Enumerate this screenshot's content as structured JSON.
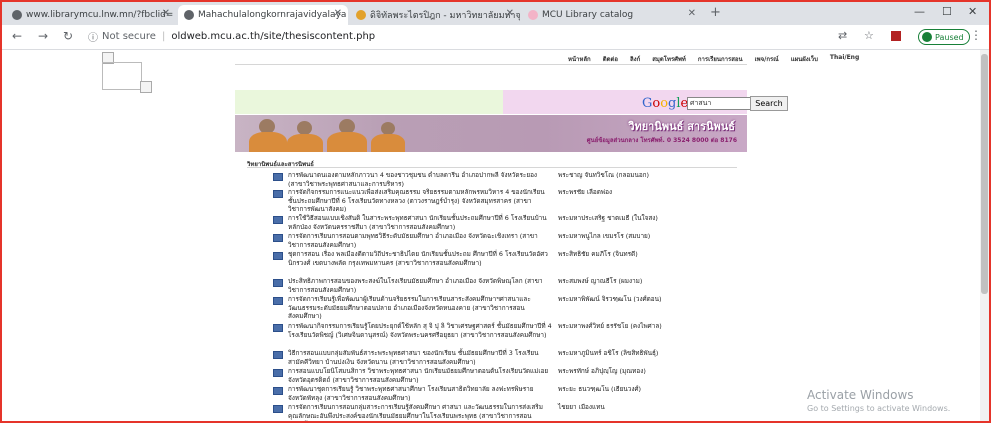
{
  "browser": {
    "tabs": [
      {
        "title": "www.librarymcu.lnw.mn/?fbclid=",
        "active": false
      },
      {
        "title": "Mahachulalongkornrajavidyalaya",
        "active": true
      },
      {
        "title": "ดิจิทัลพระไตรปิฎก - มหาวิทยาลัยมหาจุฬาฯ",
        "active": false
      },
      {
        "title": "MCU Library catalog",
        "active": false
      }
    ],
    "new_tab": "+",
    "not_secure": "Not secure",
    "url": "oldweb.mcu.ac.th/site/thesiscontent.php",
    "profile_status": "Paused"
  },
  "site": {
    "nav": [
      "หน้าหลัก",
      "ติดต่อ",
      "ลิงก์",
      "สมุดโทรศัพท์",
      "การเรียนการสอน",
      "เพจ/กรณ์",
      "แผนผังเว็บ",
      "Thai/Eng"
    ],
    "search": {
      "logo": "Google",
      "value": "ศาสนา",
      "button": "Search"
    },
    "banner": {
      "title": "วิทยานิพนธ์ สารนิพนธ์",
      "subtitle": "ศูนย์ข้อมูลส่วนกลาง โทรศัพท์. 0 3524 8000 ต่อ 8176"
    },
    "section_title": "วิทยานิพนธ์และสารนิพนธ์",
    "theses": [
      {
        "title": "การพัฒนาตนเองตามหลักภาวนา 4 ของชาวชุมชน ตำบลดารีน อำเภอปากพลี จังหวัดระยอง (สาขาวิชาพระพุทธศาสนาและการบริหาร)",
        "author": "พระชาญ จันทวิชโณ (กลอมนอก)"
      },
      {
        "title": "การจัดกิจกรรมการแนะแนวเพื่อส่งเสริมคุณธรรม จริยธรรมตามหลักพรหมวิหาร 4 ของนักเรียนชั้นประถมศึกษาปีที่ 6 โรงเรียนวัดทางหลวง (ตาวงราษฎร์บำรุง) จังหวัดสมุทรสาคร (สาขาวิชาการพัฒนาสังคม)",
        "author": "พระพรชัย เลือดพ่อง"
      },
      {
        "title": "การใช้วิธีสอนแบบเชิงสันติ ในสาระพระพุทธศาสนา นักเรียนชั้นประถมศึกษาปีที่ 6 โรงเรียนบ้านหลักป่อง จังหวัดนครราชสีมา (สาขาวิชาการสอนสังคมศึกษา)",
        "author": "พระมหาประเสริฐ ชาตเมธี (ในใจสง)"
      },
      {
        "title": "การจัดการเรียนการสอนตามพุทธวิธีระดับมัธยมศึกษา อำเภอเมือง จังหวัดฉะเชิงเทรา (สาขาวิชาการสอนสังคมศึกษา)",
        "author": "พระมหาพนูไกล เขมรโร (สมบาย)"
      },
      {
        "title": "ชุดการสอน เรื่อง พลเมืองดีตามวิถีประชาธิปไตย นักเรียนชั้นประถม ศึกษาปีที่ 6 โรงเรียนวัดอัศวนิกรวงศ์ เขตบางพลัด กรุงเทพมหานคร (สาขาวิชาการสอนสังคมศึกษา)",
        "author": "พระสิทธิชัย คมภีโร (จินทรดี)"
      },
      {
        "title": "ประสิทธิภาพการสอนของพระสงฆ์ในโรงเรียนมัธยมศึกษา อำเภอเมือง จังหวัดพิษณุโลก (สาขาวิชาการสอนสังคมศึกษา)",
        "author": "พระสมพงษ์ ญาณธีโร (ผมงาม)"
      },
      {
        "title": "การจัดการเรียนรู้เพื่อพัฒนาผู้เรียนด้านจริยธรรมในการเรียนสาระสังคมศึกษาฯศาสนาและวัฒนธรรมระดับมัธยมศึกษาตอนปลาย อำเภอเมืองจังหวัดหนองคาย (สาขาวิชาการสอนสังคมศึกษา)",
        "author": "พระมหาพิพัฒน์ จิรวฑฺฒโน (วงศ์ดอน)"
      },
      {
        "title": "การพัฒนากิจกรรมการเรียนรู้โดยประยุกต์ใช้หลัก สุ จิ ปุ ลิ วิชาเศรษฐศาสตร์ ชั้นมัธยมศึกษาปีที่ 4 โรงเรียนวัดพิชญ์ (วิเศษจินดานุสรณ์) จังหวัดพระนครศรีอยุธยา (สาขาวิชาการสอนสังคมศึกษา)",
        "author": "พระมหาพงศ์วิทย์ ธรรัชโย (คงไพศาล)"
      },
      {
        "title": "วิธีการสอนแบบกลุ่มสัมพันธ์สาระพระพุทธศาสนา ของนักเรียน ชั้นมัธยมศึกษาปีที่ 3 โรงเรียนสามัคคีวิทยา บ้านปงเงิน จังหวัดนาน (สาขาวิชาการสอนสังคมศึกษา)",
        "author": "พระมหาภูมินทร์ อชิโร (ลิขสิทธิพันธุ์)"
      },
      {
        "title": "การสอนแบบโยนิโสมนสิการ วิชาพระพุทธศาสนา นักเรียนมัธยมศึกษาตอนต้นโรงเรียนวัดแม่เอย จังหวัดอุตรดิตถ์ (สาขาวิชาการสอนสังคมศึกษา)",
        "author": "พระพรทักษ์ อภิปุญฺโญ (มุณทอง)"
      },
      {
        "title": "การพัฒนาชุดการเรียนรู้ วิชาพระพุทธศาสนาศึกษา โรงเรียนสาธิตวิทยาลัย ลงฟะทรพิษราย จังหวัดพัทลุง (สาขาวิชาการสอนสังคมศึกษา)",
        "author": "พระยะ ธนวฑฺฒโน (เธียนวงศ์)"
      },
      {
        "title": "การจัดการเรียนการสอนกลุ่มสาระการเรียนรู้สังคมศึกษา ศาสนา และวัฒนธรรมในการส่งเสริมคุณลักษณะอันพึงประสงค์ของนักเรียนมัธยมศึกษาในโรงเรียนพระพุทธ (สาขาวิชาการสอนสังคมศึกษา)",
        "author": "ไชยยา เมืองแทน"
      }
    ]
  },
  "os": {
    "activate_title": "Activate Windows",
    "activate_sub": "Go to Settings to activate Windows."
  }
}
